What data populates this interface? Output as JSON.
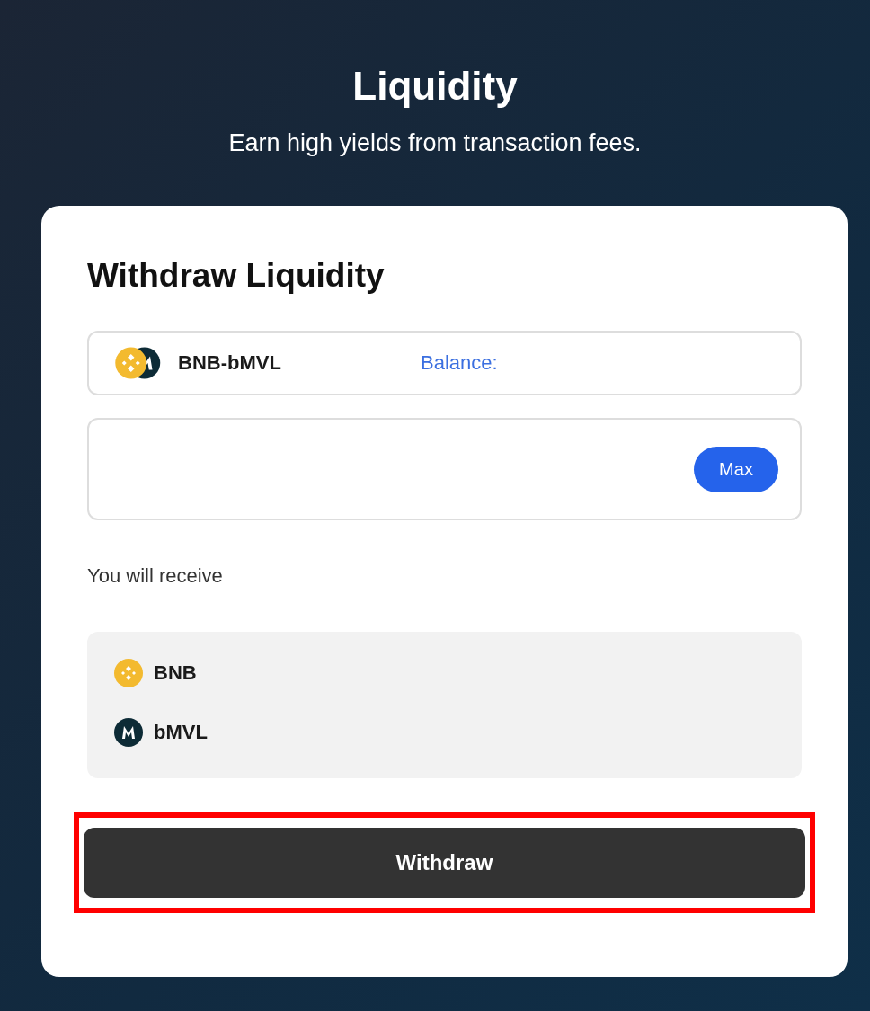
{
  "header": {
    "title": "Liquidity",
    "subtitle": "Earn high yields from transaction fees."
  },
  "card": {
    "title": "Withdraw Liquidity",
    "pair": {
      "label": "BNB-bMVL",
      "balance_label": "Balance:"
    },
    "amount": {
      "max_button": "Max"
    },
    "receive_label": "You will receive",
    "receive_tokens": [
      {
        "kind": "bnb",
        "symbol": "BNB"
      },
      {
        "kind": "mvl",
        "symbol": "bMVL"
      }
    ],
    "withdraw_button": {
      "label": "Withdraw",
      "highlighted": true
    }
  }
}
